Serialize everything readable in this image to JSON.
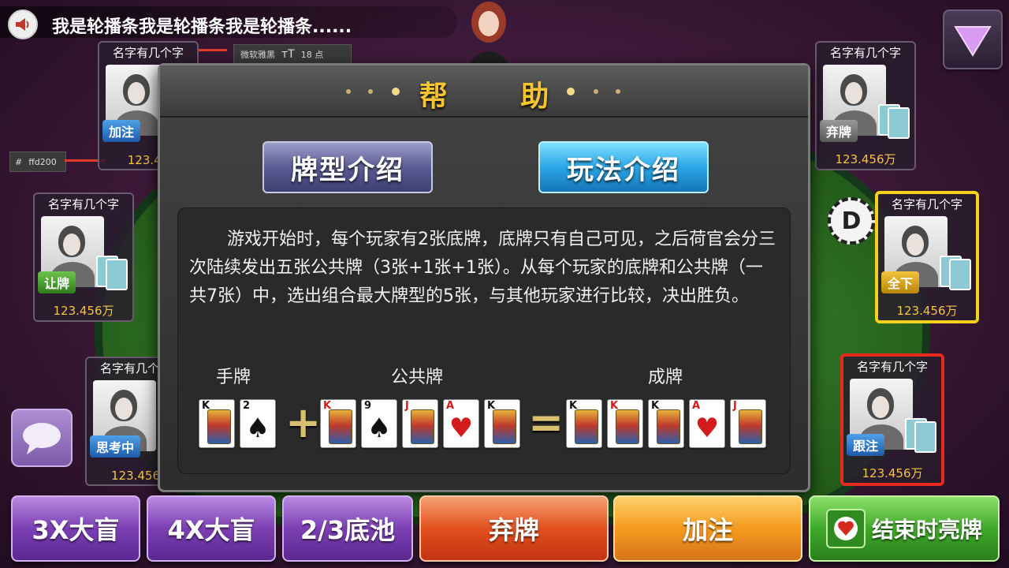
{
  "marquee": {
    "text": "我是轮播条我是轮播条我是轮播条......"
  },
  "annotations": {
    "font_label": "微软雅黑",
    "size_label": "18 点",
    "color_label": "ffd200",
    "hash": "#"
  },
  "players": [
    {
      "name": "名字有几个字",
      "status": "加注",
      "chips": "123.45"
    },
    {
      "name": "名字有几个字",
      "status": "让牌",
      "chips": "123.456万"
    },
    {
      "name": "名字有几个字",
      "status": "思考中",
      "chips": "123.456"
    },
    {
      "name": "名字有几个字",
      "status": "弃牌",
      "chips": "123.456万"
    },
    {
      "name": "名字有几个字",
      "status": "全下",
      "chips": "123.456万"
    },
    {
      "name": "名字有几个字",
      "status": "跟注",
      "chips": "123.456万"
    }
  ],
  "dealer_mark": "D",
  "dialog": {
    "title": "帮 助",
    "tabs": [
      "牌型介绍",
      "玩法介绍"
    ],
    "active_tab": "玩法介绍",
    "paragraph": "游戏开始时，每个玩家有2张底牌，底牌只有自己可见，之后荷官会分三次陆续发出五张公共牌（3张+1张+1张）。从每个玩家的底牌和公共牌（一共7张）中，选出组合最大牌型的5张，与其他玩家进行比较，决出胜负。",
    "labels": {
      "hand": "手牌",
      "community": "公共牌",
      "result": "成牌"
    },
    "hand_cards": [
      {
        "rank": "K",
        "suit": "♠",
        "face": true
      },
      {
        "rank": "2",
        "suit": "♠",
        "face": false
      }
    ],
    "community_cards": [
      {
        "rank": "K",
        "suit": "♦",
        "face": true
      },
      {
        "rank": "9",
        "suit": "♠",
        "face": false
      },
      {
        "rank": "J",
        "suit": "♦",
        "face": true
      },
      {
        "rank": "A",
        "suit": "♥",
        "face": false
      },
      {
        "rank": "K",
        "suit": "♣",
        "face": true
      }
    ],
    "result_cards": [
      {
        "rank": "K",
        "suit": "♠",
        "face": true
      },
      {
        "rank": "K",
        "suit": "♦",
        "face": true
      },
      {
        "rank": "K",
        "suit": "♣",
        "face": true
      },
      {
        "rank": "A",
        "suit": "♥",
        "face": false
      },
      {
        "rank": "J",
        "suit": "♦",
        "face": true
      }
    ],
    "plus": "+",
    "equals": "="
  },
  "bottom_bar": {
    "btn_3x": "3X大盲",
    "btn_4x": "4X大盲",
    "btn_pot": "2/3底池",
    "btn_fold": "弃牌",
    "btn_raise": "加注",
    "btn_show": "结束时亮牌"
  }
}
